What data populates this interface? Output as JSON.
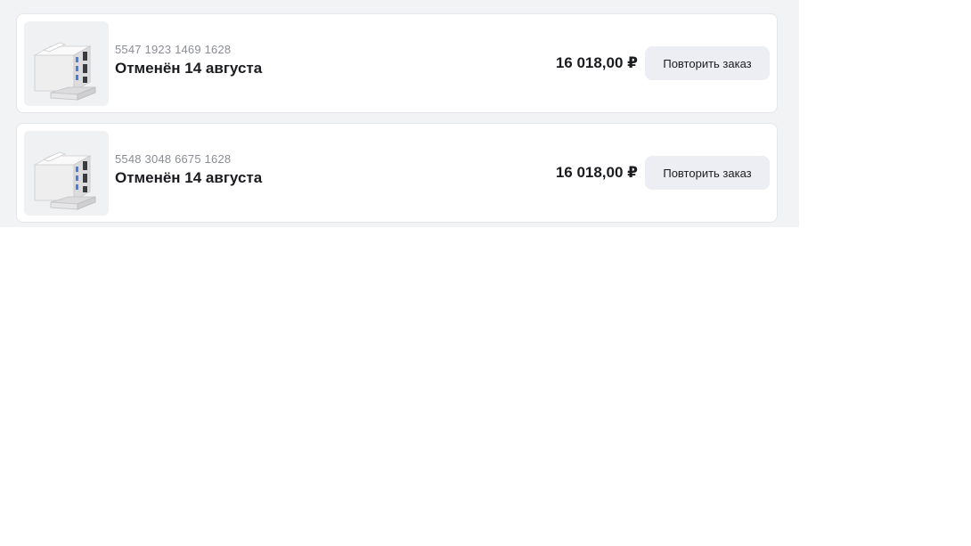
{
  "orders": [
    {
      "number": "5547 1923 1469 1628",
      "status": "Отменён 14 августа",
      "price": "16 018,00 ₽",
      "button_label": "Повторить заказ",
      "image_icon": "mini-pc-product-image"
    },
    {
      "number": "5548 3048 6675 1628",
      "status": "Отменён 14 августа",
      "price": "16 018,00 ₽",
      "button_label": "Повторить заказ",
      "image_icon": "mini-pc-product-image"
    }
  ],
  "colors": {
    "page_background": "#f2f3f5",
    "card_background": "#ffffff",
    "button_background": "#eceef3",
    "secondary_text": "#8a8d93",
    "primary_text": "#1b1c1f"
  }
}
